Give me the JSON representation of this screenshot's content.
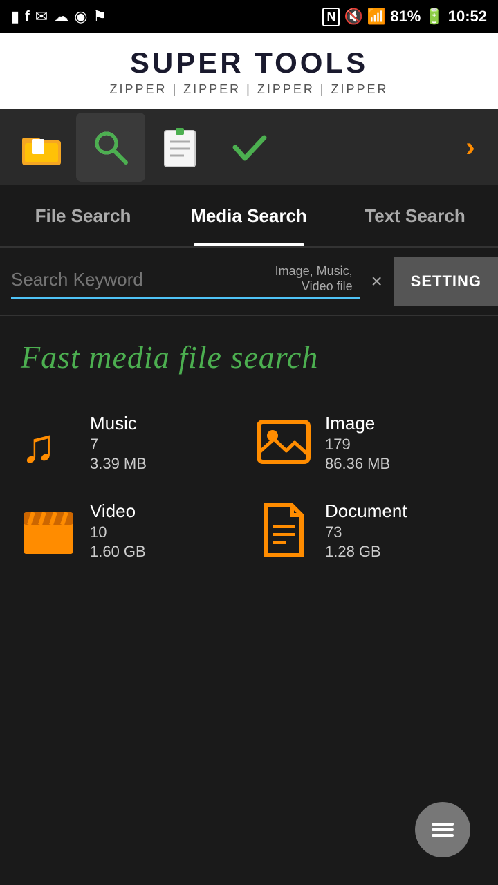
{
  "statusBar": {
    "time": "10:52",
    "battery": "81%",
    "icons": [
      "sim-icon",
      "mute-icon",
      "signal-icon",
      "battery-icon"
    ]
  },
  "banner": {
    "title": "SUPER TOOLS",
    "subtitle": "ZIPPER | ZIPPER | ZIPPER | ZIPPER"
  },
  "toolbar": {
    "items": [
      {
        "name": "file-tool",
        "active": false
      },
      {
        "name": "search-tool",
        "active": true
      },
      {
        "name": "notes-tool",
        "active": false
      },
      {
        "name": "check-tool",
        "active": false
      }
    ],
    "chevronLabel": "›"
  },
  "tabs": {
    "items": [
      {
        "id": "file-search",
        "label": "File Search",
        "active": false
      },
      {
        "id": "media-search",
        "label": "Media Search",
        "active": true
      },
      {
        "id": "text-search",
        "label": "Text Search",
        "active": false
      }
    ]
  },
  "searchBar": {
    "placeholder": "Search Keyword",
    "hint": "Image, Music, Video file",
    "clearBtn": "×",
    "settingLabel": "SETTING"
  },
  "mainContent": {
    "tagline": "Fast media file search",
    "stats": [
      {
        "id": "music",
        "label": "Music",
        "count": "7",
        "size": "3.39 MB"
      },
      {
        "id": "image",
        "label": "Image",
        "count": "179",
        "size": "86.36 MB"
      },
      {
        "id": "video",
        "label": "Video",
        "count": "10",
        "size": "1.60 GB"
      },
      {
        "id": "document",
        "label": "Document",
        "count": "73",
        "size": "1.28 GB"
      }
    ]
  },
  "fab": {
    "icon": "menu-icon"
  }
}
